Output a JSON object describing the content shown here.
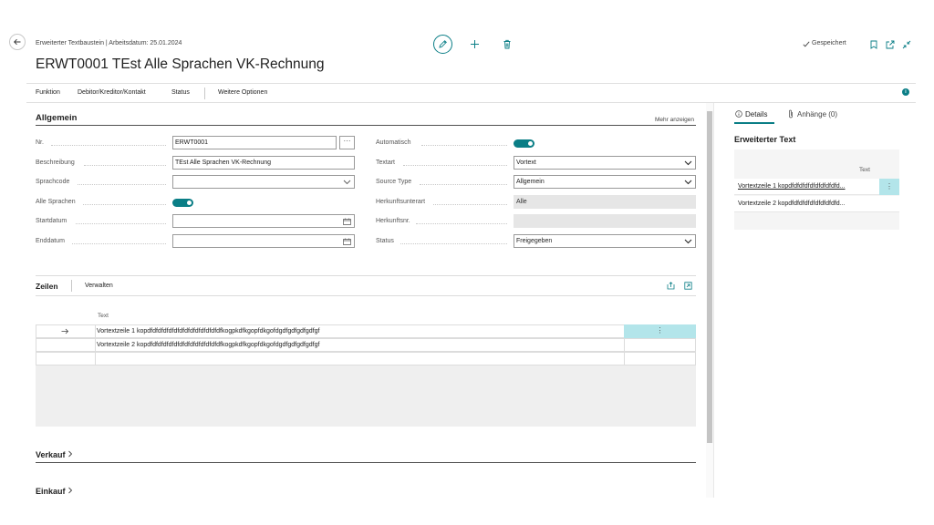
{
  "header": {
    "breadcrumb": "Erweiterter Textbaustein | Arbeitsdatum: 25.01.2024",
    "title": "ERWT0001 TEst Alle Sprachen VK-Rechnung",
    "saved_label": "Gespeichert"
  },
  "actions": [
    "Funktion",
    "Debitor/Kreditor/Kontakt",
    "Status",
    "Weitere Optionen"
  ],
  "general": {
    "section_title": "Allgemein",
    "more_label": "Mehr anzeigen",
    "left_fields": [
      {
        "label": "Nr.",
        "value": "ERWT0001"
      },
      {
        "label": "Beschreibung",
        "value": "TEst Alle Sprachen VK-Rechnung"
      },
      {
        "label": "Sprachcode",
        "value": ""
      },
      {
        "label": "Alle Sprachen",
        "value": "on"
      },
      {
        "label": "Startdatum",
        "value": ""
      },
      {
        "label": "Enddatum",
        "value": ""
      }
    ],
    "right_fields": [
      {
        "label": "Automatisch",
        "value": "on"
      },
      {
        "label": "Textart",
        "value": "Vortext"
      },
      {
        "label": "Source Type",
        "value": "Allgemein"
      },
      {
        "label": "Herkunftsunterart",
        "value": "Alle"
      },
      {
        "label": "Herkunftsnr.",
        "value": ""
      },
      {
        "label": "Status",
        "value": "Freigegeben"
      }
    ]
  },
  "lines": {
    "section_title": "Zeilen",
    "manage_label": "Verwalten",
    "column_header": "Text",
    "rows": [
      "Vortextzeile 1 kopdfdfdfdfdfdfdfdfdfdfdfdfdfdfkogpkdfkgopfdkgofdgdfgdfgdfgdfgf",
      "Vortextzeile 2 kopdfdfdfdfdfdfdfdfdfdfdfdfdfdfkogpkdfkgopfdkgofdgdfgdfgdfgdfgf"
    ]
  },
  "collapsed_sections": [
    "Verkauf",
    "Einkauf"
  ],
  "factbox": {
    "tab_details": "Details",
    "tab_attachments": "Anhänge (0)",
    "title": "Erweiterter Text",
    "column_header": "Text",
    "rows": [
      "Vortextzeile 1 kopdfdfdfdfdfdfdfdfdfd...",
      "Vortextzeile 2 kopdfdfdfdfdfdfdfdfdfd..."
    ]
  },
  "colors": {
    "accent": "#0a7e86",
    "selected_row": "#b3e5ea"
  },
  "icons": [
    "back-arrow-icon",
    "edit-icon",
    "add-icon",
    "delete-icon",
    "checkmark-icon",
    "bookmark-icon",
    "open-new-window-icon",
    "collapse-icon",
    "info-icon",
    "ellipsis-icon",
    "calendar-icon",
    "chevron-down-icon",
    "share-icon",
    "expand-icon",
    "row-arrow-icon",
    "chevron-right-icon"
  ]
}
